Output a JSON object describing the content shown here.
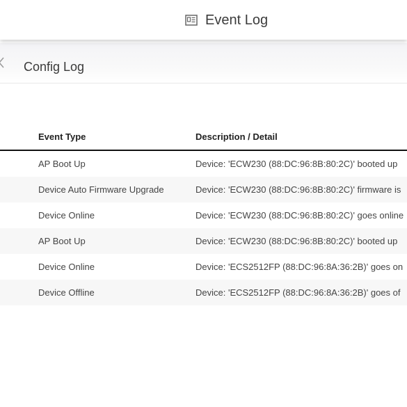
{
  "header": {
    "title": "Event Log",
    "icon": "event-log-icon"
  },
  "tabs": {
    "active_label": "Config Log"
  },
  "table": {
    "columns": [
      "Event Type",
      "Description / Detail"
    ],
    "rows": [
      {
        "event_type": "AP Boot Up",
        "description": "Device: 'ECW230 (88:DC:96:8B:80:2C)' booted up"
      },
      {
        "event_type": "Device Auto Firmware Upgrade",
        "description": "Device: 'ECW230 (88:DC:96:8B:80:2C)' firmware is"
      },
      {
        "event_type": "Device Online",
        "description": "Device: 'ECW230 (88:DC:96:8B:80:2C)' goes online"
      },
      {
        "event_type": "AP Boot Up",
        "description": "Device: 'ECW230 (88:DC:96:8B:80:2C)' booted up"
      },
      {
        "event_type": "Device Online",
        "description": "Device: 'ECS2512FP (88:DC:96:8A:36:2B)' goes on"
      },
      {
        "event_type": "Device Offline",
        "description": "Device: 'ECS2512FP (88:DC:96:8A:36:2B)' goes of"
      }
    ]
  },
  "colors": {
    "header_bg": "#ffffff",
    "text": "#333333",
    "row_alt": "#f7f7f7",
    "header_rule": "#111111"
  }
}
